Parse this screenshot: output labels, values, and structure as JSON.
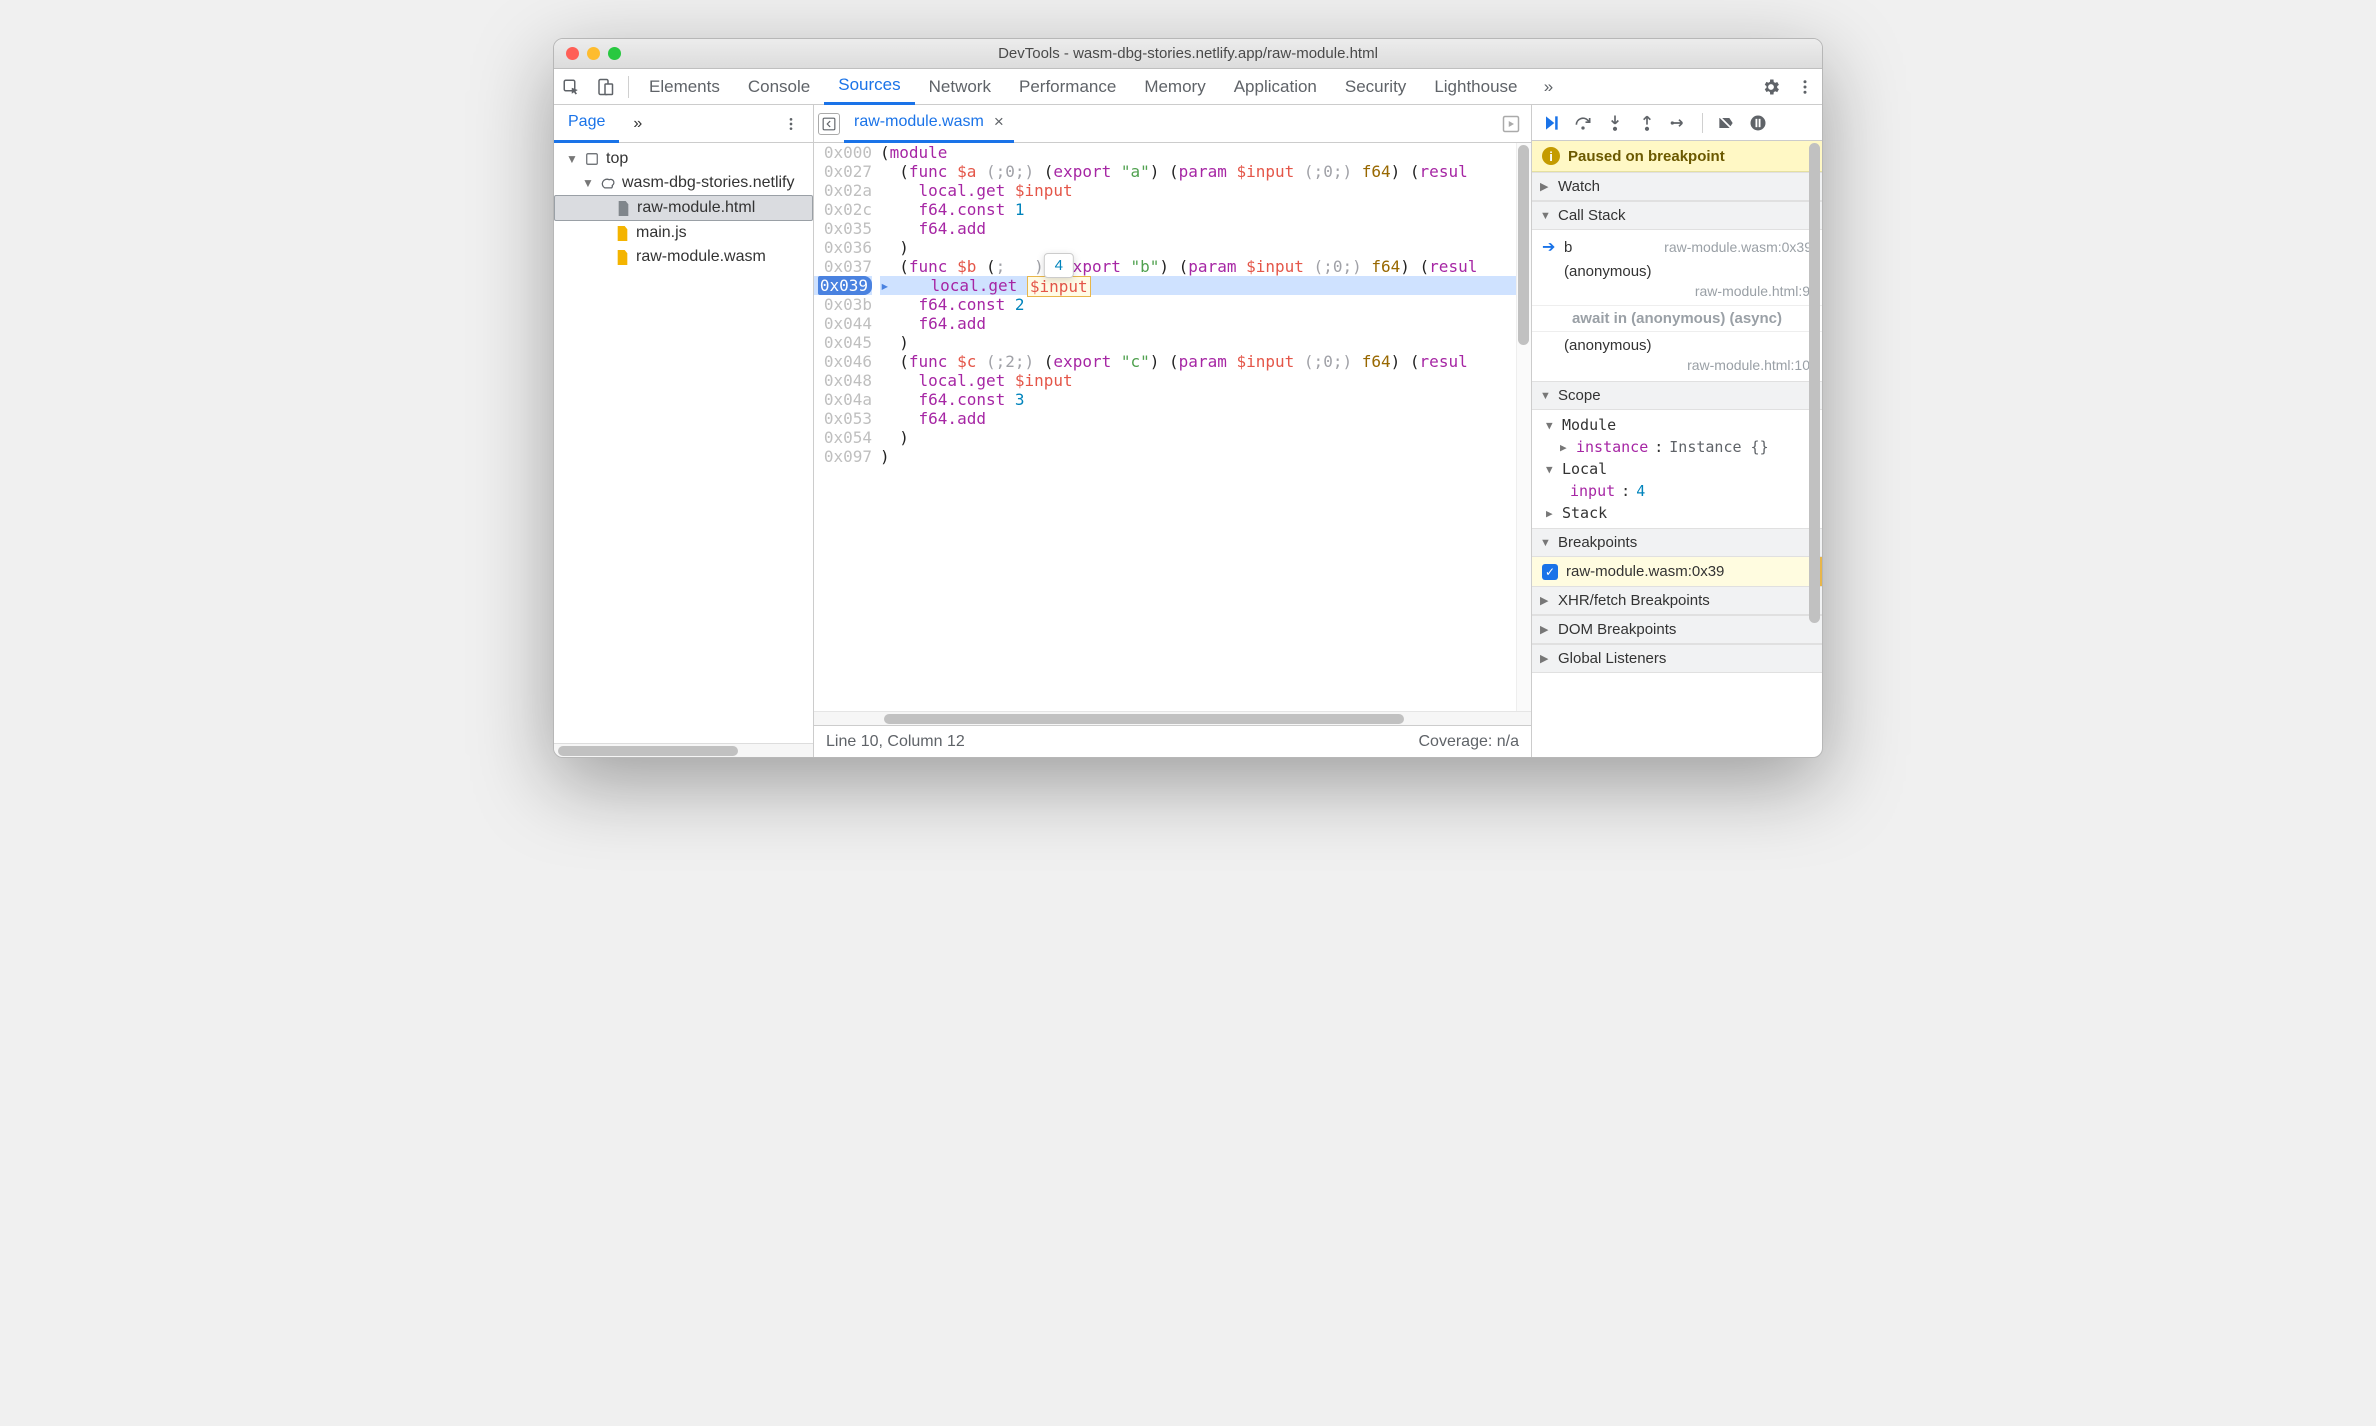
{
  "window": {
    "title": "DevTools - wasm-dbg-stories.netlify.app/raw-module.html"
  },
  "tabs": [
    "Elements",
    "Console",
    "Sources",
    "Network",
    "Performance",
    "Memory",
    "Application",
    "Security",
    "Lighthouse"
  ],
  "activeTab": "Sources",
  "leftPanel": {
    "tab": "Page",
    "tree": {
      "root": "top",
      "domain": "wasm-dbg-stories.netlify",
      "files": [
        "raw-module.html",
        "main.js",
        "raw-module.wasm"
      ],
      "selectedIndex": 0
    }
  },
  "editor": {
    "filename": "raw-module.wasm",
    "hoverValue": "4",
    "lines": [
      {
        "addr": "0x000",
        "indent": 0,
        "tokens": [
          [
            "punc",
            "("
          ],
          [
            "kw",
            "module"
          ]
        ]
      },
      {
        "addr": "0x027",
        "indent": 1,
        "tokens": [
          [
            "punc",
            "("
          ],
          [
            "kw",
            "func"
          ],
          [
            "punc",
            " "
          ],
          [
            "func",
            "$a"
          ],
          [
            "punc",
            " "
          ],
          [
            "gray",
            "(;0;)"
          ],
          [
            "punc",
            " ("
          ],
          [
            "kw",
            "export"
          ],
          [
            "punc",
            " "
          ],
          [
            "str",
            "\"a\""
          ],
          [
            "punc",
            ") ("
          ],
          [
            "kw",
            "param"
          ],
          [
            "punc",
            " "
          ],
          [
            "func",
            "$input"
          ],
          [
            "punc",
            " "
          ],
          [
            "gray",
            "(;0;)"
          ],
          [
            "punc",
            " "
          ],
          [
            "var",
            "f64"
          ],
          [
            "punc",
            ") ("
          ],
          [
            "kw",
            "resul"
          ]
        ]
      },
      {
        "addr": "0x02a",
        "indent": 2,
        "tokens": [
          [
            "kw",
            "local.get"
          ],
          [
            "punc",
            " "
          ],
          [
            "func",
            "$input"
          ]
        ]
      },
      {
        "addr": "0x02c",
        "indent": 2,
        "tokens": [
          [
            "kw",
            "f64.const"
          ],
          [
            "punc",
            " "
          ],
          [
            "num",
            "1"
          ]
        ]
      },
      {
        "addr": "0x035",
        "indent": 2,
        "tokens": [
          [
            "kw",
            "f64.add"
          ]
        ]
      },
      {
        "addr": "0x036",
        "indent": 1,
        "tokens": [
          [
            "punc",
            ")"
          ]
        ]
      },
      {
        "addr": "0x037",
        "indent": 1,
        "tokens": [
          [
            "punc",
            "("
          ],
          [
            "kw",
            "func"
          ],
          [
            "punc",
            " "
          ],
          [
            "func",
            "$b"
          ],
          [
            "punc",
            " ("
          ],
          [
            "gray",
            ";   )"
          ],
          [
            "punc",
            " ("
          ],
          [
            "kw",
            "export"
          ],
          [
            "punc",
            " "
          ],
          [
            "str",
            "\"b\""
          ],
          [
            "punc",
            ") ("
          ],
          [
            "kw",
            "param"
          ],
          [
            "punc",
            " "
          ],
          [
            "func",
            "$input"
          ],
          [
            "punc",
            " "
          ],
          [
            "gray",
            "(;0;)"
          ],
          [
            "punc",
            " "
          ],
          [
            "var",
            "f64"
          ],
          [
            "punc",
            ") ("
          ],
          [
            "kw",
            "resul"
          ]
        ]
      },
      {
        "addr": "0x039",
        "indent": 2,
        "hl": true,
        "bp": true,
        "tokens": [
          [
            "kw",
            "local.get"
          ],
          [
            "punc",
            " "
          ],
          [
            "inspect",
            "$input"
          ]
        ]
      },
      {
        "addr": "0x03b",
        "indent": 2,
        "tokens": [
          [
            "kw",
            "f64.const"
          ],
          [
            "punc",
            " "
          ],
          [
            "num",
            "2"
          ]
        ]
      },
      {
        "addr": "0x044",
        "indent": 2,
        "tokens": [
          [
            "kw",
            "f64.add"
          ]
        ]
      },
      {
        "addr": "0x045",
        "indent": 1,
        "tokens": [
          [
            "punc",
            ")"
          ]
        ]
      },
      {
        "addr": "0x046",
        "indent": 1,
        "tokens": [
          [
            "punc",
            "("
          ],
          [
            "kw",
            "func"
          ],
          [
            "punc",
            " "
          ],
          [
            "func",
            "$c"
          ],
          [
            "punc",
            " "
          ],
          [
            "gray",
            "(;2;)"
          ],
          [
            "punc",
            " ("
          ],
          [
            "kw",
            "export"
          ],
          [
            "punc",
            " "
          ],
          [
            "str",
            "\"c\""
          ],
          [
            "punc",
            ") ("
          ],
          [
            "kw",
            "param"
          ],
          [
            "punc",
            " "
          ],
          [
            "func",
            "$input"
          ],
          [
            "punc",
            " "
          ],
          [
            "gray",
            "(;0;)"
          ],
          [
            "punc",
            " "
          ],
          [
            "var",
            "f64"
          ],
          [
            "punc",
            ") ("
          ],
          [
            "kw",
            "resul"
          ]
        ]
      },
      {
        "addr": "0x048",
        "indent": 2,
        "tokens": [
          [
            "kw",
            "local.get"
          ],
          [
            "punc",
            " "
          ],
          [
            "func",
            "$input"
          ]
        ]
      },
      {
        "addr": "0x04a",
        "indent": 2,
        "tokens": [
          [
            "kw",
            "f64.const"
          ],
          [
            "punc",
            " "
          ],
          [
            "num",
            "3"
          ]
        ]
      },
      {
        "addr": "0x053",
        "indent": 2,
        "tokens": [
          [
            "kw",
            "f64.add"
          ]
        ]
      },
      {
        "addr": "0x054",
        "indent": 1,
        "tokens": [
          [
            "punc",
            ")"
          ]
        ]
      },
      {
        "addr": "0x097",
        "indent": 0,
        "tokens": [
          [
            "punc",
            ")"
          ]
        ]
      }
    ],
    "statusLeft": "Line 10, Column 12",
    "statusRight": "Coverage: n/a"
  },
  "debugger": {
    "banner": "Paused on breakpoint",
    "sections": {
      "watch": "Watch",
      "callstack": "Call Stack",
      "scope": "Scope",
      "breakpoints": "Breakpoints",
      "xhr": "XHR/fetch Breakpoints",
      "dom": "DOM Breakpoints",
      "global": "Global Listeners"
    },
    "callstack": [
      {
        "fn": "b",
        "loc": "raw-module.wasm:0x39",
        "current": true
      },
      {
        "fn": "(anonymous)",
        "loc": "raw-module.html:9"
      },
      {
        "await": "await in (anonymous) (async)"
      },
      {
        "fn": "(anonymous)",
        "loc": "raw-module.html:10"
      }
    ],
    "scope": {
      "module": {
        "label": "Module",
        "instance_k": "instance",
        "instance_v": "Instance {}"
      },
      "local": {
        "label": "Local",
        "input_k": "input",
        "input_v": "4"
      },
      "stack": {
        "label": "Stack"
      }
    },
    "breakpoints": [
      {
        "checked": true,
        "label": "raw-module.wasm:0x39"
      }
    ]
  }
}
